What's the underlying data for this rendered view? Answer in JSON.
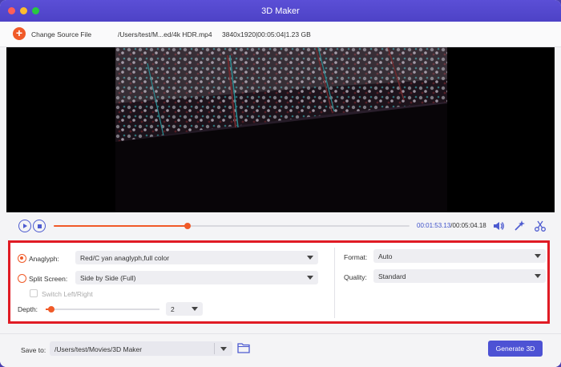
{
  "window": {
    "title": "3D Maker",
    "traffic_lights": [
      "#fe5f57",
      "#febc2e",
      "#28c840"
    ]
  },
  "toolbar": {
    "change_source_label": "Change Source File",
    "file_path": "/Users/test/M...ed/4k HDR.mp4",
    "file_info": "3840x1920|00:05:04|1.23 GB"
  },
  "player": {
    "progress_fraction": 0.376,
    "current_time": "00:01:53.13",
    "total_time": "/00:05:04.18"
  },
  "settings": {
    "anaglyph": {
      "label": "Anaglyph:",
      "selected": true,
      "value": "Red/C yan anaglyph,full color"
    },
    "split_screen": {
      "label": "Split Screen:",
      "selected": false,
      "value": "Side by Side (Full)"
    },
    "switch_lr": {
      "label": "Switch Left/Right",
      "checked": false,
      "enabled": false
    },
    "depth": {
      "label": "Depth:",
      "value": "2",
      "slider_fraction": 0.05
    },
    "format": {
      "label": "Format:",
      "value": "Auto"
    },
    "quality": {
      "label": "Quality:",
      "value": "Standard"
    }
  },
  "footer": {
    "save_label": "Save to:",
    "save_path": "/Users/test/Movies/3D Maker",
    "generate_label": "Generate 3D"
  },
  "colors": {
    "accent": "#f05a28",
    "primary": "#4d52d4",
    "highlight_border": "#e01b24"
  }
}
